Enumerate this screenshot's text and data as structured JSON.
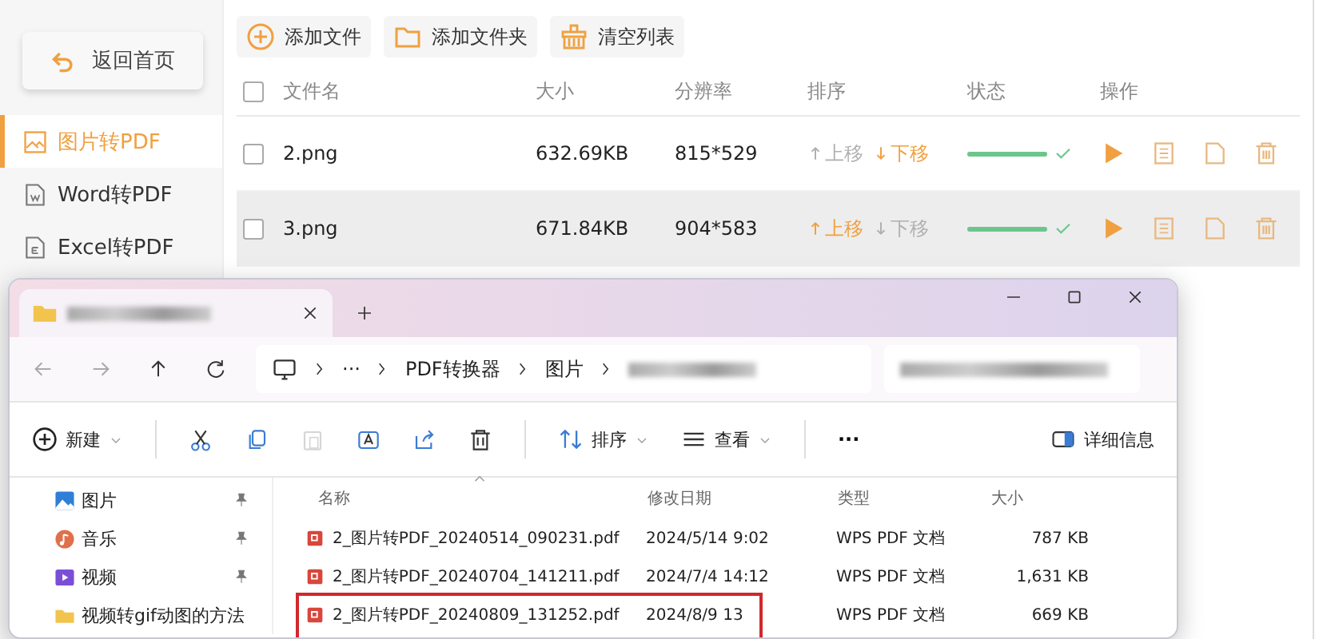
{
  "app": {
    "back_button": "返回首页",
    "sidebar": [
      {
        "label": "图片转PDF",
        "selected": true
      },
      {
        "label": "Word转PDF",
        "selected": false
      },
      {
        "label": "Excel转PDF",
        "selected": false
      }
    ],
    "toolbar": [
      "添加文件",
      "添加文件夹",
      "清空列表"
    ],
    "table": {
      "select_all_checked": false,
      "columns": [
        "文件名",
        "大小",
        "分辨率",
        "排序",
        "状态",
        "操作"
      ],
      "rows": [
        {
          "checked": false,
          "name": "2.png",
          "size": "632.69KB",
          "resolution": "815*529",
          "move_up": "上移",
          "move_up_disabled": true,
          "move_down": "下移",
          "move_down_disabled": false,
          "level": 1,
          "done": true,
          "hovered": false
        },
        {
          "checked": false,
          "name": "3.png",
          "size": "671.84KB",
          "resolution": "904*583",
          "move_up": "上移",
          "move_up_disabled": false,
          "move_down": "下移",
          "move_down_disabled": true,
          "level": 1,
          "done": true,
          "hovered": true
        }
      ]
    }
  },
  "explorer": {
    "breadcrumb": [
      "···",
      "PDF转换器",
      "图片"
    ],
    "toolbar": [
      {
        "kind": "menu",
        "label": "新建"
      },
      {
        "kind": "sep"
      },
      {
        "kind": "icon",
        "disabled": false
      },
      {
        "kind": "icon",
        "disabled": false
      },
      {
        "kind": "icon",
        "disabled": true
      },
      {
        "kind": "icon",
        "disabled": false
      },
      {
        "kind": "icon",
        "disabled": false
      },
      {
        "kind": "icon",
        "disabled": false
      },
      {
        "kind": "sep"
      },
      {
        "kind": "menu",
        "label": "排序"
      },
      {
        "kind": "menu",
        "label": "查看"
      },
      {
        "kind": "sep"
      },
      {
        "kind": "text",
        "label": "···"
      }
    ],
    "details_button": "详细信息",
    "nav": [
      {
        "label": "图片",
        "pinned": true
      },
      {
        "label": "音乐",
        "pinned": true
      },
      {
        "label": "视频",
        "pinned": true
      },
      {
        "label": "视频转gif动图的方法",
        "pinned": false
      }
    ],
    "columns": [
      "名称",
      "修改日期",
      "类型",
      "大小"
    ],
    "files": [
      {
        "name": "2_图片转PDF_20240514_090231.pdf",
        "date": "2024/5/14 9:02",
        "type": "WPS PDF 文档",
        "size": "787 KB",
        "marked": false
      },
      {
        "name": "2_图片转PDF_20240704_141211.pdf",
        "date": "2024/7/4 14:12",
        "type": "WPS PDF 文档",
        "size": "1,631 KB",
        "marked": false
      },
      {
        "name": "2_图片转PDF_20240809_131252.pdf",
        "date": "2024/8/9 13",
        "type": "WPS PDF 文档",
        "size": "669 KB",
        "marked": true
      }
    ]
  }
}
